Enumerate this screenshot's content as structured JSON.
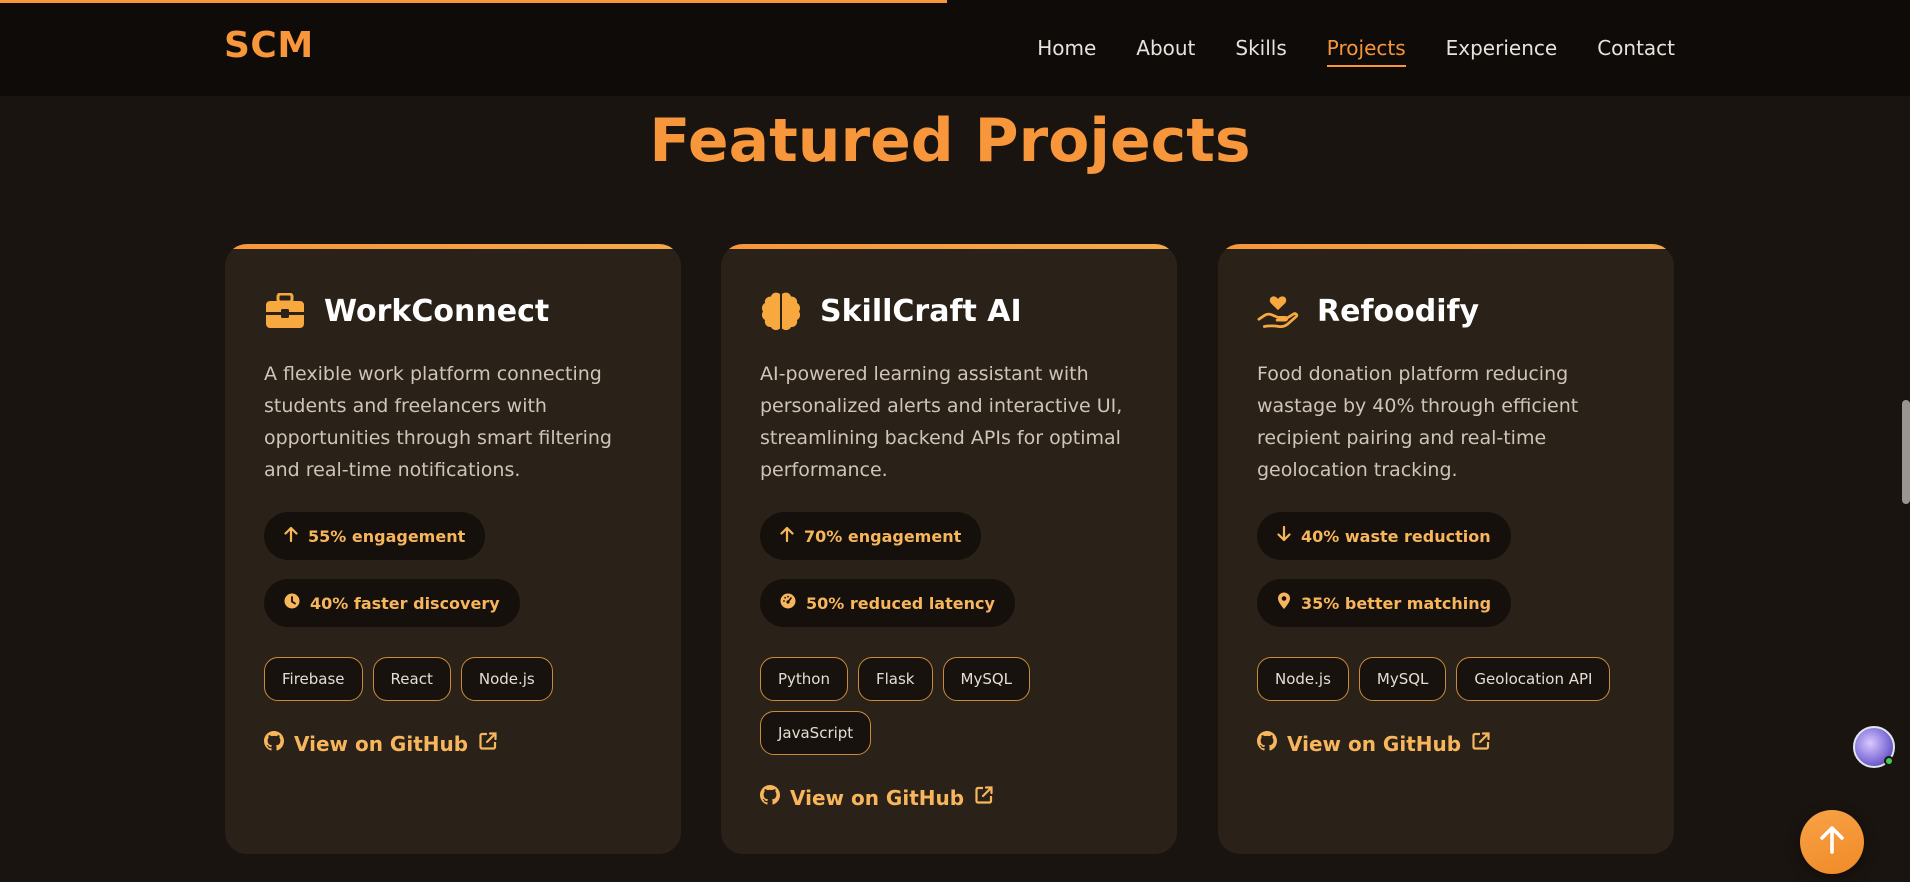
{
  "page": {
    "scroll_progress_percent": 49.6,
    "accent_color": "#f7963a"
  },
  "header": {
    "logo": "SCM",
    "nav": [
      {
        "label": "Home",
        "active": false
      },
      {
        "label": "About",
        "active": false
      },
      {
        "label": "Skills",
        "active": false
      },
      {
        "label": "Projects",
        "active": true
      },
      {
        "label": "Experience",
        "active": false
      },
      {
        "label": "Contact",
        "active": false
      }
    ]
  },
  "section": {
    "title": "Featured Projects"
  },
  "projects": [
    {
      "icon": "briefcase-icon",
      "title": "WorkConnect",
      "description": "A flexible work platform connecting students and freelancers with opportunities through smart filtering and real-time notifications.",
      "metrics": [
        {
          "icon": "arrow-up-icon",
          "label": "55% engagement"
        },
        {
          "icon": "clock-icon",
          "label": "40% faster discovery"
        }
      ],
      "tags": [
        "Firebase",
        "React",
        "Node.js"
      ],
      "link": "View on GitHub"
    },
    {
      "icon": "brain-icon",
      "title": "SkillCraft AI",
      "description": "AI-powered learning assistant with personalized alerts and interactive UI, streamlining backend APIs for optimal performance.",
      "metrics": [
        {
          "icon": "arrow-up-icon",
          "label": "70% engagement"
        },
        {
          "icon": "gauge-icon",
          "label": "50% reduced latency"
        }
      ],
      "tags": [
        "Python",
        "Flask",
        "MySQL",
        "JavaScript"
      ],
      "link": "View on GitHub"
    },
    {
      "icon": "hand-heart-icon",
      "title": "Refoodify",
      "description": "Food donation platform reducing wastage by 40% through efficient recipient pairing and real-time geolocation tracking.",
      "metrics": [
        {
          "icon": "arrow-down-icon",
          "label": "40% waste reduction"
        },
        {
          "icon": "map-pin-icon",
          "label": "35% better matching"
        }
      ],
      "tags": [
        "Node.js",
        "MySQL",
        "Geolocation API"
      ],
      "link": "View on GitHub"
    }
  ],
  "widgets": {
    "chat_avatar": "chat-assistant-avatar",
    "scroll_to_top_icon": "arrow-up-icon"
  }
}
